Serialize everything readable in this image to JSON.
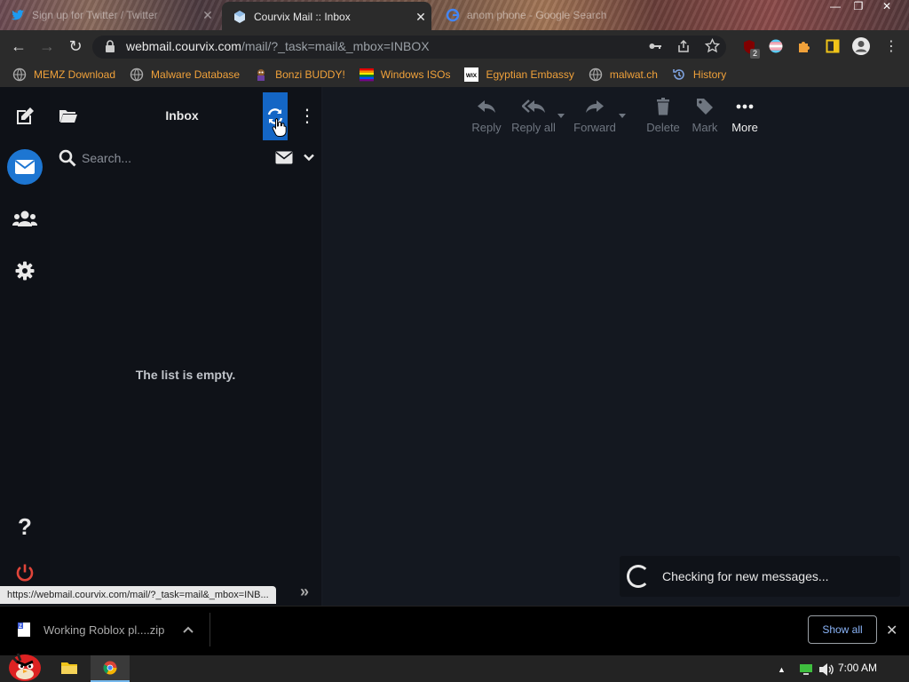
{
  "browser": {
    "tabs": [
      {
        "title": "Sign up for Twitter / Twitter"
      },
      {
        "title": "Courvix Mail :: Inbox"
      },
      {
        "title": "anom phone - Google Search"
      }
    ],
    "url": {
      "domain": "webmail.courvix.com",
      "path": "/mail/?_task=mail&_mbox=INBOX"
    },
    "bookmarks": [
      {
        "label": "MEMZ Download"
      },
      {
        "label": "Malware Database"
      },
      {
        "label": "Bonzi BUDDY!"
      },
      {
        "label": "Windows ISOs"
      },
      {
        "label": "Egyptian Embassy"
      },
      {
        "label": "malwat.ch"
      },
      {
        "label": "History"
      }
    ],
    "ext_badge": "2",
    "status_url": "https://webmail.courvix.com/mail/?_task=mail&_mbox=INB..."
  },
  "mail": {
    "folder_title": "Inbox",
    "search_placeholder": "Search...",
    "empty_message": "The list is empty.",
    "toolbar": {
      "reply": "Reply",
      "reply_all": "Reply all",
      "forward": "Forward",
      "delete": "Delete",
      "mark": "Mark",
      "more": "More"
    },
    "toast": "Checking for new messages...",
    "accent_color": "#1d76d2"
  },
  "downloads": {
    "file_name": "Working Roblox pl....zip",
    "show_all": "Show all"
  },
  "taskbar": {
    "clock": "7:00 AM"
  }
}
